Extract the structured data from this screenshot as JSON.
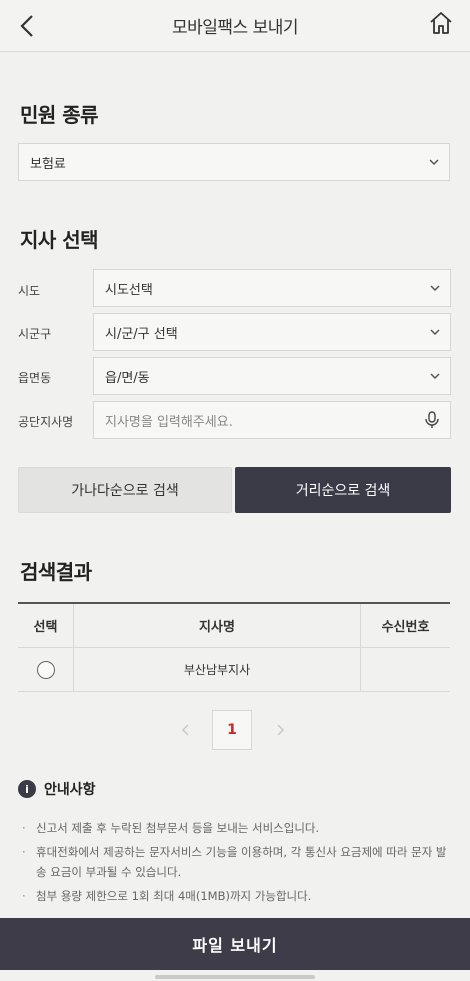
{
  "header": {
    "title": "모바일팩스 보내기"
  },
  "civil": {
    "title": "민원 종류",
    "selected": "보험료"
  },
  "branch": {
    "title": "지사 선택",
    "sido_label": "시도",
    "sido_value": "시도선택",
    "sigungu_label": "시군구",
    "sigungu_value": "시/군/구 선택",
    "eup_label": "읍면동",
    "eup_value": "읍/면/동",
    "office_label": "공단지사명",
    "office_placeholder": "지사명을 입력해주세요."
  },
  "buttons": {
    "alpha_sort": "가나다순으로 검색",
    "distance_sort": "거리순으로 검색",
    "send": "파일 보내기"
  },
  "results": {
    "title": "검색결과",
    "columns": [
      "선택",
      "지사명",
      "수신번호"
    ],
    "rows": [
      {
        "name": "부산남부지사",
        "number": ""
      }
    ]
  },
  "pager": {
    "current": "1"
  },
  "notice": {
    "title": "안내사항",
    "items": [
      "신고서 제출 후 누락된 첨부문서 등을 보내는 서비스입니다.",
      "휴대전화에서 제공하는 문자서비스 기능을 이용하며, 각 통신사 요금제에 따라 문자 발송 요금이 부과될 수 있습니다.",
      "첨부 용량 제한으로 1회 최대 4매(1MB)까지 가능합니다."
    ]
  },
  "colors": {
    "primary": "#3b3a47",
    "page_active": "#c62828",
    "background": "#f1f1ef"
  },
  "icons": {
    "back": "chevron-left-icon",
    "home": "home-icon",
    "mic": "microphone-icon",
    "info": "info-icon"
  }
}
